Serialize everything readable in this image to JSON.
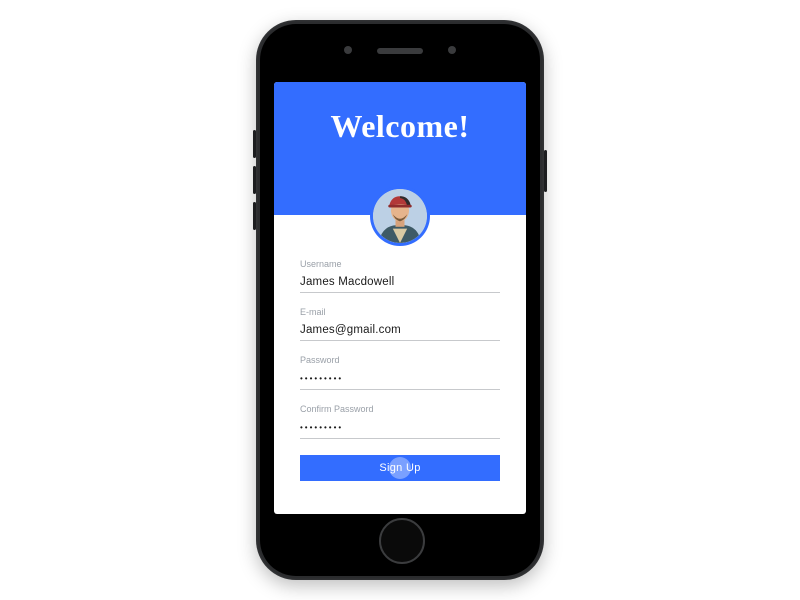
{
  "hero": {
    "title": "Welcome!"
  },
  "form": {
    "username": {
      "label": "Username",
      "value": "James Macdowell"
    },
    "email": {
      "label": "E-mail",
      "value": "James@gmail.com"
    },
    "password": {
      "label": "Password",
      "value": "•••••••••"
    },
    "confirm": {
      "label": "Confirm Password",
      "value": "•••••••••"
    },
    "submit": "Sign Up"
  },
  "colors": {
    "accent": "#336dff"
  }
}
